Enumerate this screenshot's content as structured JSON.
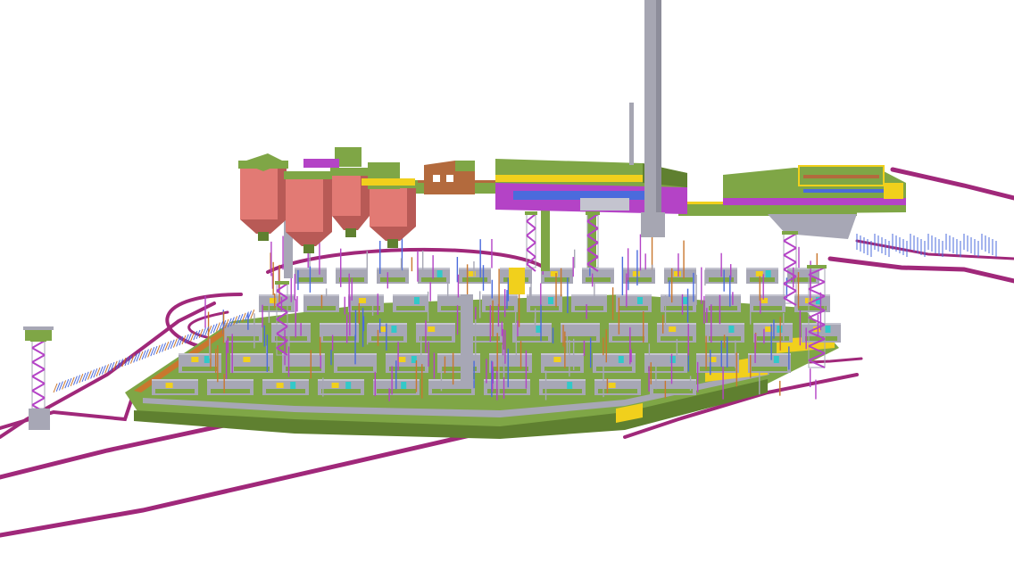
{
  "colors": {
    "background": "#ffffff",
    "road": "#a0287a",
    "road_dark": "#7d1f60",
    "deck_green": "#7fa646",
    "deck_green_dark": "#5f8030",
    "concrete_grey": "#a7a7b5",
    "concrete_light": "#c4c4cf",
    "steel_purple": "#b443c6",
    "steel_blue": "#4b6bdc",
    "rebar_orange": "#c9772e",
    "silo_red": "#e27a74",
    "silo_red_dark": "#b85a56",
    "yellow": "#f1d01c",
    "cyan": "#32c9c9",
    "brown": "#b36a3d",
    "chimney": "#a6a6b2"
  },
  "scene": {
    "silo_count": 4,
    "stair_towers": 5,
    "chimneys": 2
  }
}
